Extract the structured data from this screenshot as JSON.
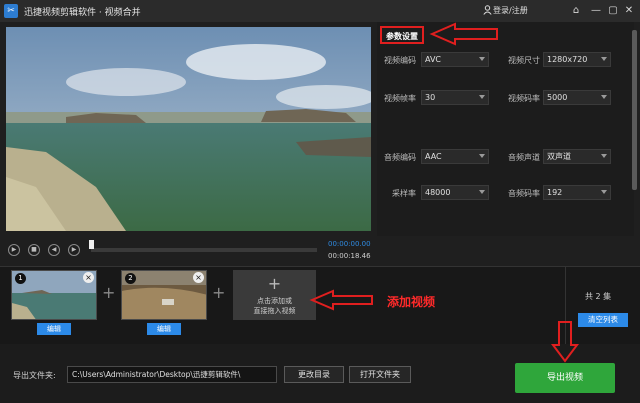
{
  "titlebar": {
    "app_name": "迅捷视频剪辑软件 · 视频合并",
    "login": "登录/注册",
    "icons": [
      "app-icon",
      "user-icon",
      "home-icon",
      "minimize-icon",
      "maximize-icon",
      "close-icon"
    ]
  },
  "params": {
    "title": "参数设置",
    "video_codec": {
      "label": "视频编码",
      "value": "AVC"
    },
    "video_size": {
      "label": "视频尺寸",
      "value": "1280x720"
    },
    "frame_rate": {
      "label": "视频帧率",
      "value": "30"
    },
    "video_bitrate": {
      "label": "视频码率",
      "value": "5000"
    },
    "audio_codec": {
      "label": "音频编码",
      "value": "AAC"
    },
    "audio_channel": {
      "label": "音频声道",
      "value": "双声道"
    },
    "sample_rate": {
      "label": "采样率",
      "value": "48000"
    },
    "audio_bitrate": {
      "label": "音频码率",
      "value": "192"
    }
  },
  "player": {
    "current_time": "00:00:00.00",
    "total_time": "00:00:18.46",
    "progress": 0.0
  },
  "clips": [
    {
      "index": "1",
      "edit_label": "编辑"
    },
    {
      "index": "2",
      "edit_label": "编辑"
    }
  ],
  "add_box": {
    "plus": "+",
    "line1": "点击添加或",
    "line2": "直接拖入视频"
  },
  "annotation": "添加视频",
  "list": {
    "count": "共 2 集",
    "clear_label": "清空列表"
  },
  "output": {
    "label": "导出文件夹:",
    "path": "C:\\Users\\Administrator\\Desktop\\迅捷剪辑软件\\",
    "change_dir": "更改目录",
    "open_folder": "打开文件夹",
    "export": "导出视频"
  },
  "colors": {
    "accent_blue": "#2c8ae8",
    "export_green": "#2fa63b",
    "annotation_red": "#e01f1f"
  }
}
